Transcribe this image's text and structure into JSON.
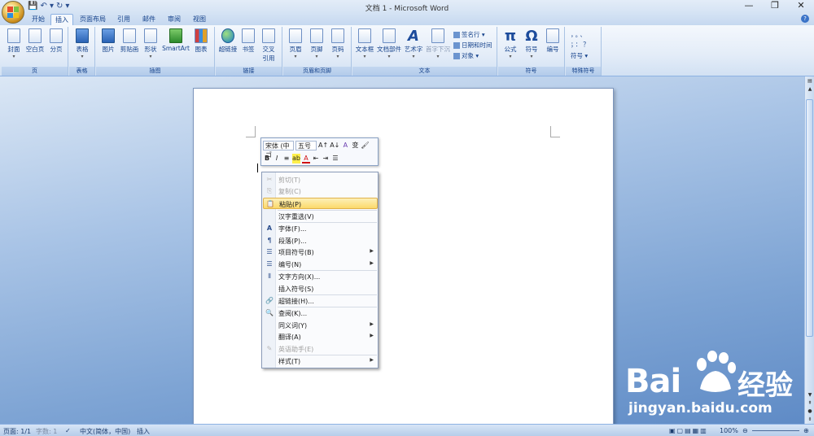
{
  "window": {
    "title": "文档 1 - Microsoft Word",
    "controls": [
      "—",
      "❐",
      "✕"
    ]
  },
  "qat": [
    "💾",
    "↶ ▾",
    "↻",
    "▾"
  ],
  "tabs": [
    "开始",
    "插入",
    "页面布局",
    "引用",
    "邮件",
    "审阅",
    "视图"
  ],
  "active_tab": "插入",
  "ribbon": {
    "page_group": {
      "label": "页",
      "buttons": [
        "封面",
        "空白页",
        "分页"
      ]
    },
    "table_group": {
      "label": "表格",
      "buttons": [
        "表格"
      ]
    },
    "illust_group": {
      "label": "插图",
      "buttons": [
        "图片",
        "剪贴画",
        "形状",
        "SmartArt",
        "图表"
      ]
    },
    "link_group": {
      "label": "链接",
      "buttons": [
        "超链接",
        "书签",
        "交叉",
        "引用"
      ]
    },
    "hf_group": {
      "label": "页眉和页脚",
      "buttons": [
        "页眉",
        "页脚",
        "页码"
      ]
    },
    "text_group": {
      "label": "文本",
      "buttons": [
        "文本框",
        "文档部件",
        "艺术字",
        "首字下沉"
      ],
      "small": [
        "签名行",
        "日期和时间",
        "对象"
      ]
    },
    "sym_group": {
      "label": "符号",
      "buttons": [
        "公式",
        "符号",
        "编号"
      ]
    },
    "special_group": {
      "label": "特殊符号",
      "buttons": [
        "符号"
      ],
      "glyphs": [
        "，",
        "。",
        "、",
        "；",
        "：",
        "？"
      ]
    }
  },
  "minibar": {
    "font": "宋体 (中ゴ",
    "size": "五号",
    "row1_icons": [
      "A↑",
      "A↓",
      "A",
      "变",
      "🖌"
    ],
    "row2_icons": [
      "B",
      "I",
      "≡",
      "ab",
      "A",
      "⇤",
      "⇥",
      "☰"
    ]
  },
  "context_menu": [
    {
      "icon": "✂",
      "label": "剪切(T)",
      "disabled": true
    },
    {
      "icon": "⎘",
      "label": "复制(C)",
      "disabled": true
    },
    {
      "icon": "📋",
      "label": "粘贴(P)",
      "highlight": true
    },
    {
      "icon": "",
      "label": "汉字重选(V)"
    },
    {
      "icon": "A",
      "label": "字体(F)..."
    },
    {
      "icon": "¶",
      "label": "段落(P)..."
    },
    {
      "icon": "☰",
      "label": "项目符号(B)",
      "submenu": true
    },
    {
      "icon": "☰",
      "label": "编号(N)",
      "submenu": true
    },
    {
      "icon": "⫴",
      "label": "文字方向(X)..."
    },
    {
      "icon": "",
      "label": "插入符号(S)"
    },
    {
      "icon": "🔗",
      "label": "超链接(H)..."
    },
    {
      "icon": "🔍",
      "label": "查阅(K)..."
    },
    {
      "icon": "",
      "label": "同义词(Y)",
      "submenu": true
    },
    {
      "icon": "",
      "label": "翻译(A)",
      "submenu": true
    },
    {
      "icon": "✎",
      "label": "英语助手(E)",
      "disabled": true
    },
    {
      "icon": "",
      "label": "样式(T)",
      "submenu": true
    }
  ],
  "status": {
    "page": "页面: 1/1",
    "words": "字数: 1",
    "lang": "中文(简体，中国)",
    "mode": "插入",
    "zoom": "100%"
  },
  "watermark": {
    "brand": "Bai",
    "brand2": "经验",
    "url": "jingyan.baidu.com"
  }
}
